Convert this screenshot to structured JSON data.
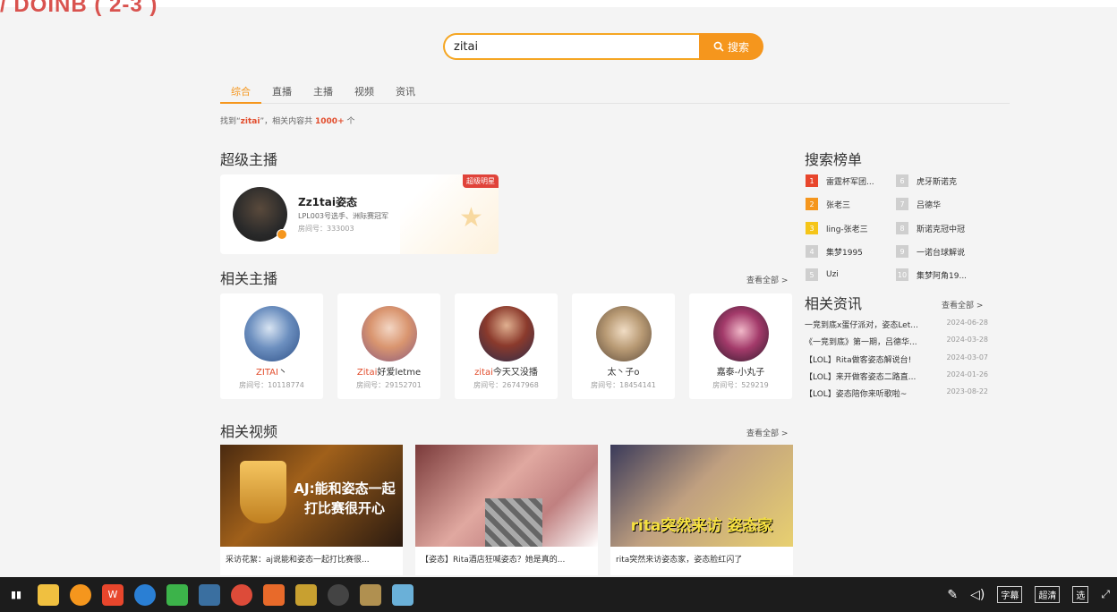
{
  "overlay": {
    "title": "/ DOINB ( 2-3 )"
  },
  "search": {
    "value": "zitai",
    "button_label": "搜索"
  },
  "tabs": [
    {
      "label": "综合",
      "active": true
    },
    {
      "label": "直播",
      "active": false
    },
    {
      "label": "主播",
      "active": false
    },
    {
      "label": "视频",
      "active": false
    },
    {
      "label": "资讯",
      "active": false
    }
  ],
  "result": {
    "prefix": "找到“",
    "keyword": "zitai",
    "middle": "”，相关内容共",
    "count": "1000+",
    "suffix": "个"
  },
  "super_anchor": {
    "section_title": "超级主播",
    "badge": "超级明星",
    "name": "Zz1tai姿态",
    "desc": "LPL003号选手、洲际赛冠军",
    "room": "房间号：333003"
  },
  "related_anchors": {
    "section_title": "相关主播",
    "view_all": "查看全部 >",
    "items": [
      {
        "name_hl": "ZITAI",
        "name_rest": "丶",
        "room": "房间号：10118774"
      },
      {
        "name_hl": "Zitai",
        "name_rest": "好爱letme",
        "room": "房间号：29152701"
      },
      {
        "name_hl": "zitai",
        "name_rest": "今天又没播",
        "room": "房间号：26747968"
      },
      {
        "name_hl": "",
        "name_rest": "太丶子o",
        "room": "房间号：18454141"
      },
      {
        "name_hl": "",
        "name_rest": "嘉泰-小丸子",
        "room": "房间号：529219"
      }
    ]
  },
  "related_videos": {
    "section_title": "相关视频",
    "view_all": "查看全部 >",
    "items": [
      {
        "title": "采访花絮：aj说能和姿态一起打比赛很...",
        "thumb_text": "AJ:能和姿态一起打比赛很开心"
      },
      {
        "title": "【姿态】Rita酒店狂喊姿态？她是真的...",
        "thumb_text": ""
      },
      {
        "title": "rita突然来访姿态家，姿态脸红闪了",
        "thumb_text": "rita突然来访 姿态家"
      }
    ]
  },
  "rank": {
    "section_title": "搜索榜单",
    "items": [
      {
        "num": "1",
        "label": "雷霆杯军团...",
        "color": "#e8462c"
      },
      {
        "num": "2",
        "label": "张老三",
        "color": "#f5961d"
      },
      {
        "num": "3",
        "label": "ling-张老三",
        "color": "#f5c518"
      },
      {
        "num": "4",
        "label": "集梦1995",
        "color": "#cfcfcf"
      },
      {
        "num": "5",
        "label": "Uzi",
        "color": "#cfcfcf"
      },
      {
        "num": "6",
        "label": "虎牙斯诺克",
        "color": "#cfcfcf"
      },
      {
        "num": "7",
        "label": "吕德华",
        "color": "#cfcfcf"
      },
      {
        "num": "8",
        "label": "斯诺克冠中冠",
        "color": "#cfcfcf"
      },
      {
        "num": "9",
        "label": "一诺台球解说",
        "color": "#cfcfcf"
      },
      {
        "num": "10",
        "label": "集梦阿角19...",
        "color": "#cfcfcf"
      }
    ]
  },
  "news": {
    "section_title": "相关资讯",
    "view_all": "查看全部 >",
    "items": [
      {
        "title": "一竞到底x蛋仔派对，姿态Let...",
        "date": "2024-06-28"
      },
      {
        "title": "《一竞到底》第一期，吕德华...",
        "date": "2024-03-28"
      },
      {
        "title": "【LOL】Rita做客姿态解说台!",
        "date": "2024-03-07"
      },
      {
        "title": "【LOL】来开做客姿态二路直...",
        "date": "2024-01-26"
      },
      {
        "title": "【LOL】姿态陪你来听歌啦~",
        "date": "2023-08-22"
      }
    ]
  },
  "taskbar": {
    "right_tags": [
      "字幕",
      "超清",
      "选"
    ]
  }
}
